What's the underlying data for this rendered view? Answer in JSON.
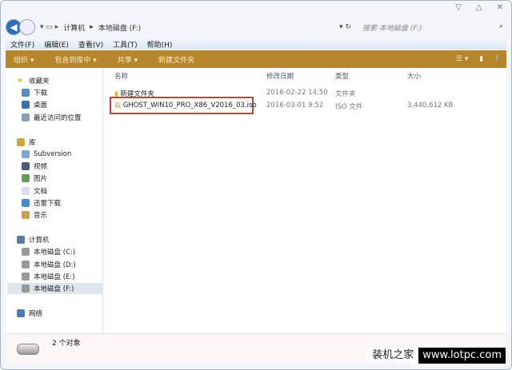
{
  "address": {
    "crumbs": [
      "计算机",
      "本地磁盘 (F:)"
    ],
    "search_placeholder": "搜索 本地磁盘 (F:)"
  },
  "menu": [
    "文件(F)",
    "编辑(E)",
    "查看(V)",
    "工具(T)",
    "帮助(H)"
  ],
  "toolbar": {
    "organize": "组织 ▾",
    "include": "包含到库中 ▾",
    "share": "共享 ▾",
    "new_folder": "新建文件夹"
  },
  "sidebar": {
    "favorites": "收藏夹",
    "downloads": "下载",
    "desktop": "桌面",
    "recent": "最近访问的位置",
    "libraries": "库",
    "subversion": "Subversion",
    "videos": "视频",
    "pictures": "图片",
    "docs": "文档",
    "xunlei": "迅雷下载",
    "music": "音乐",
    "computer": "计算机",
    "c": "本地磁盘 (C:)",
    "d": "本地磁盘 (D:)",
    "e": "本地磁盘 (E:)",
    "f": "本地磁盘 (F:)",
    "network": "网络"
  },
  "columns": {
    "name": "名称",
    "date": "修改日期",
    "type": "类型",
    "size": "大小"
  },
  "files": [
    {
      "name": "新建文件夹",
      "date": "2016-02-22 14:50",
      "type": "文件夹",
      "size": ""
    },
    {
      "name": "GHOST_WIN10_PRO_X86_V2016_03.iso",
      "date": "2016-03-01 9:52",
      "type": "ISO 文件",
      "size": "3,440,612 KB"
    }
  ],
  "status": "2 个对象",
  "watermark": {
    "cn": "装机之家",
    "url": "www.lotpc.com"
  },
  "colors": {
    "toolbar": "#b7862c",
    "highlight": "#c9423a"
  }
}
